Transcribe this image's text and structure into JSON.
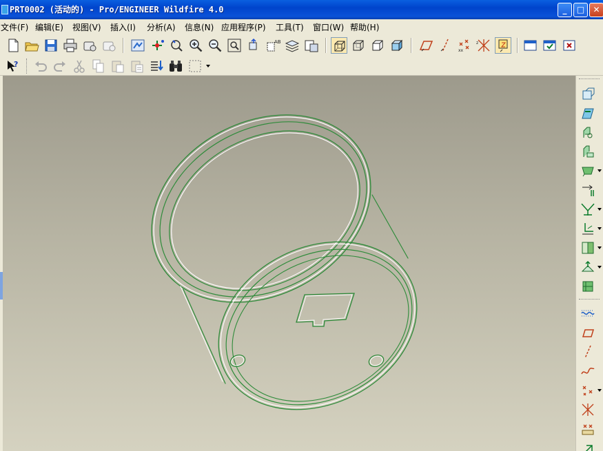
{
  "window": {
    "title": "PRT0002 (活动的) - Pro/ENGINEER Wildfire 4.0",
    "min_glyph": "_",
    "max_glyph": "□",
    "close_glyph": "✕"
  },
  "menu": {
    "items": [
      {
        "label": "文件(F)"
      },
      {
        "label": "编辑(E)"
      },
      {
        "label": "视图(V)"
      },
      {
        "label": "插入(I)"
      },
      {
        "label": "分析(A)"
      },
      {
        "label": "信息(N)"
      },
      {
        "label": "应用程序(P)"
      },
      {
        "label": "工具(T)"
      },
      {
        "label": "窗口(W)"
      },
      {
        "label": "帮助(H)"
      }
    ]
  },
  "toolbar_main": {
    "file_tools": [
      "new-file-icon",
      "open-folder-icon",
      "save-icon",
      "print-icon",
      "send-mail-icon",
      "send-mail-options-icon"
    ],
    "view_tools": [
      "repaint-icon",
      "spin-center-icon",
      "orient-mode-icon",
      "zoom-in-icon",
      "zoom-out-icon",
      "refit-icon",
      "reorient-icon",
      "saved-views-icon",
      "layers-icon",
      "view-manager-icon"
    ],
    "display_style": [
      "wireframe-icon",
      "hidden-line-icon",
      "no-hidden-icon",
      "shaded-icon"
    ],
    "datum_display": [
      "datum-planes-icon",
      "datum-axes-icon",
      "datum-points-icon",
      "coordinate-systems-icon",
      "annotation-display-icon"
    ],
    "window_tools": [
      "window-icon",
      "activate-window-icon",
      "close-window-icon"
    ],
    "active_display_style": "wireframe-icon",
    "active_datum_tool": "annotation-display-icon"
  },
  "toolbar_edit": {
    "tools": [
      "context-help-icon",
      "undo-icon",
      "redo-icon",
      "cut-icon",
      "copy-icon",
      "paste-icon",
      "paste-special-icon",
      "regenerate-icon",
      "find-icon",
      "select-box-icon"
    ]
  },
  "feature_toolbar": {
    "tools": [
      "hole-icon",
      "shell-icon",
      "rib-icon",
      "draft-icon",
      "round-icon",
      "chamfer-icon",
      "pattern-icon",
      "mirror-icon",
      "merge-icon",
      "trim-icon",
      "offset-icon",
      "extrude-icon",
      "sketch-icon",
      "datum-plane-icon",
      "datum-axis-icon",
      "datum-curve-icon",
      "datum-point-icon",
      "coordinate-system-icon",
      "analysis-feature-icon",
      "more-tools-icon"
    ]
  },
  "colors": {
    "titlebar": "#0a52d8",
    "chrome": "#ece9d8",
    "viewport_top": "#9d9a8c",
    "viewport_bottom": "#d5d2c0",
    "model_edges": "#2e8b3a",
    "model_highlight": "#ffffff"
  }
}
